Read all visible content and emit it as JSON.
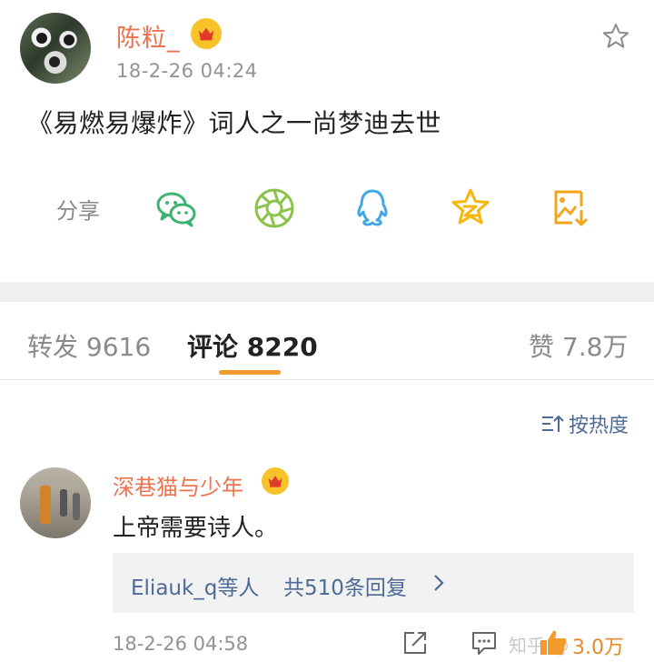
{
  "post": {
    "author": "陈粒_",
    "timestamp": "18-2-26 04:24",
    "text": "《易燃易爆炸》词人之一尚梦迪去世"
  },
  "share": {
    "label": "分享",
    "targets": [
      "wechat-icon",
      "moments-icon",
      "qq-icon",
      "qzone-icon",
      "save-image-icon"
    ]
  },
  "tabs": {
    "repost": "转发 9616",
    "comment": "评论 8220",
    "like": "赞 7.8万"
  },
  "sort": {
    "label": "按热度"
  },
  "comment": {
    "author": "深巷猫与少年",
    "text": "上帝需要诗人。",
    "replies_who": "Eliauk_q等人",
    "replies_count": "共510条回复",
    "timestamp": "18-2-26 04:58",
    "like_count": "3.0万"
  },
  "watermark": "知乎 @",
  "colors": {
    "accent_orange": "#eb7350",
    "link_blue": "#4d6a96",
    "tab_underline": "#f39a2c",
    "vip_gold": "#f8c32a"
  }
}
